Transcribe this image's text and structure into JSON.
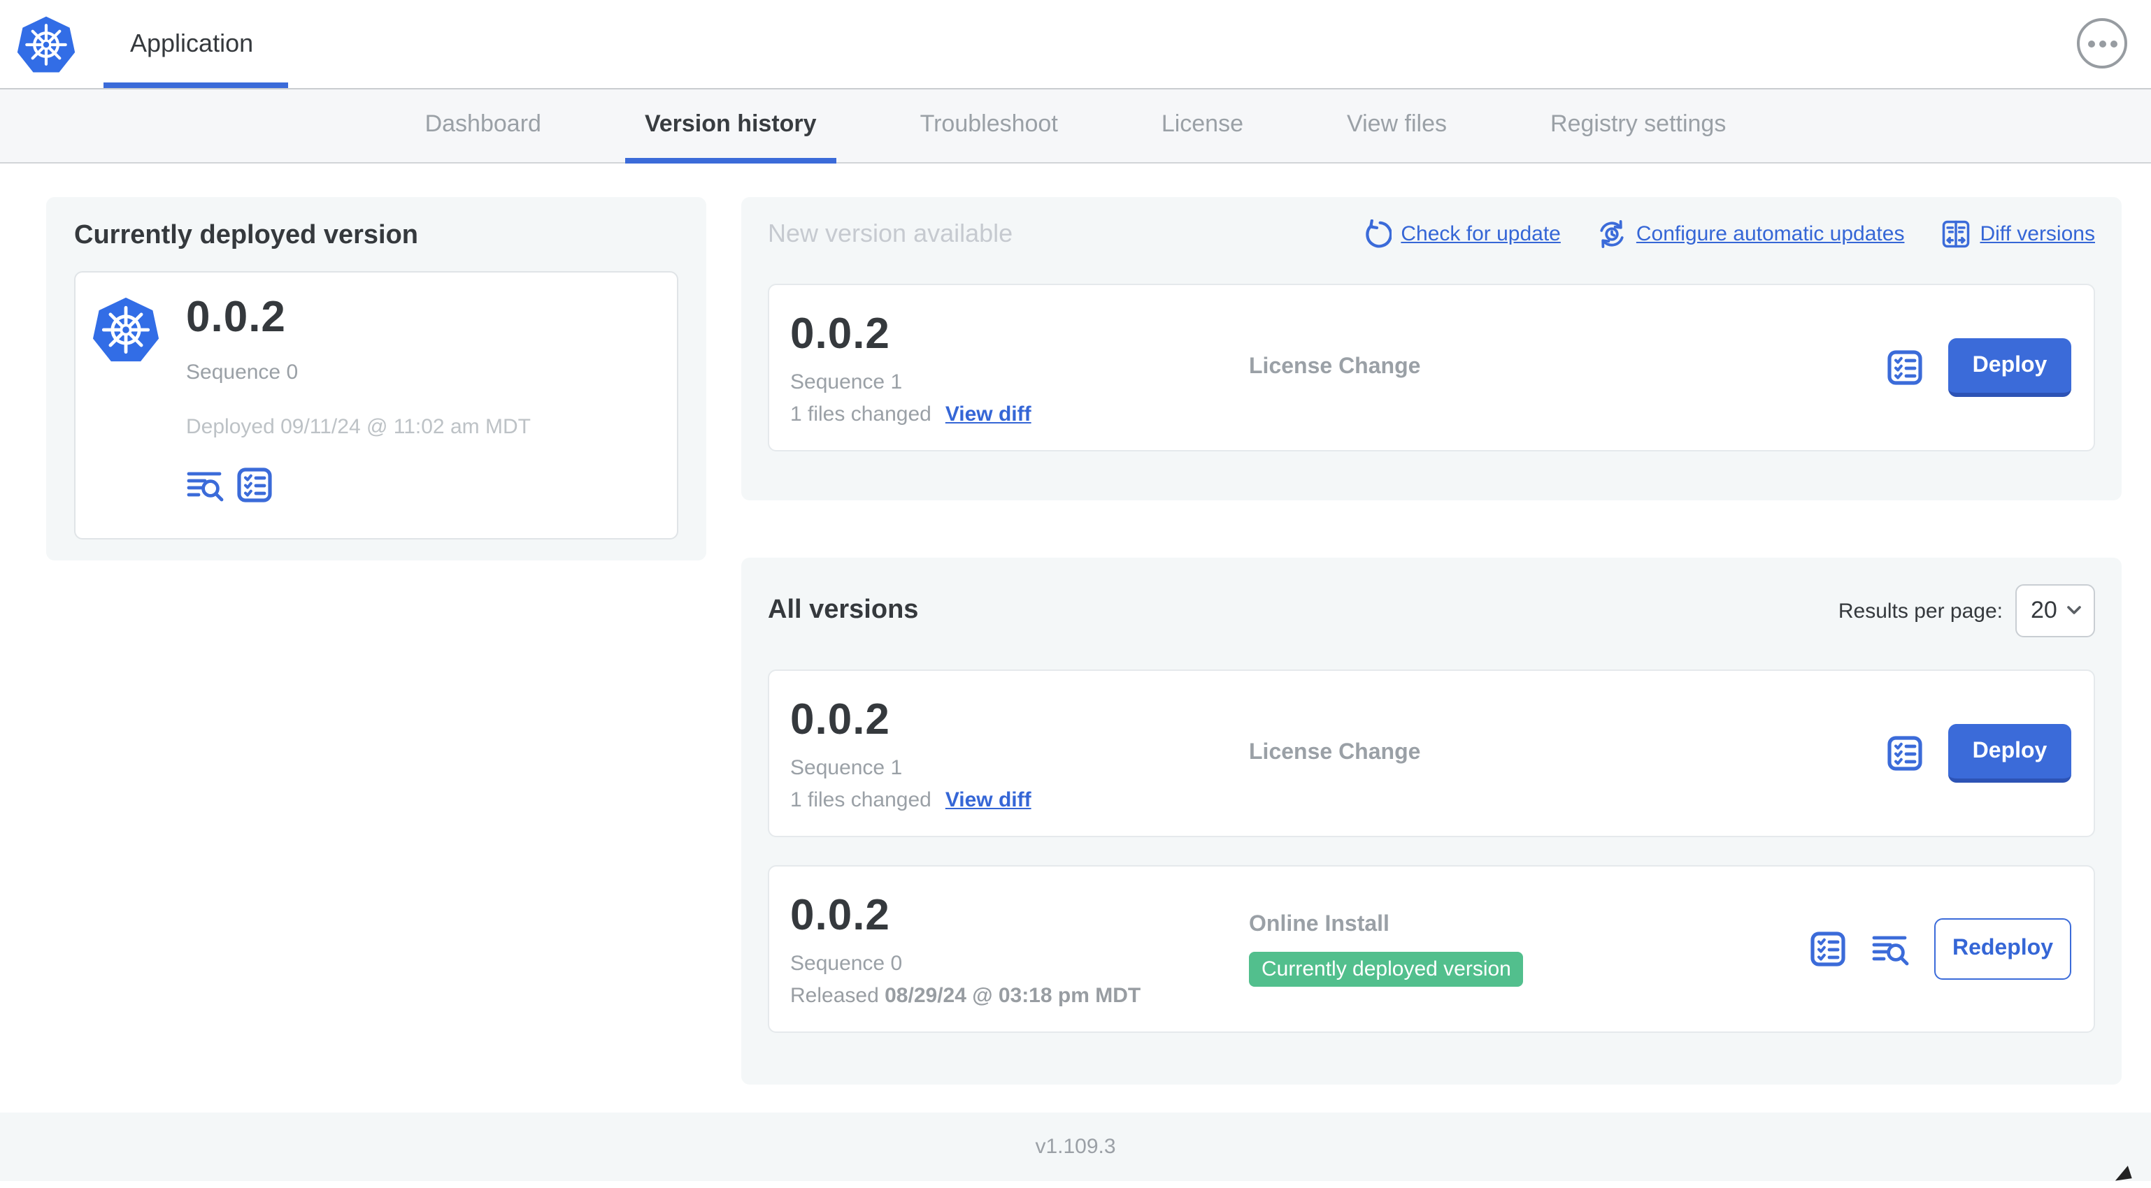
{
  "header": {
    "app_title": "Application"
  },
  "nav": {
    "tabs": [
      {
        "label": "Dashboard",
        "active": false
      },
      {
        "label": "Version history",
        "active": true
      },
      {
        "label": "Troubleshoot",
        "active": false
      },
      {
        "label": "License",
        "active": false
      },
      {
        "label": "View files",
        "active": false
      },
      {
        "label": "Registry settings",
        "active": false
      }
    ]
  },
  "currently_deployed": {
    "heading": "Currently deployed version",
    "version": "0.0.2",
    "sequence": "Sequence 0",
    "deployed": "Deployed 09/11/24 @ 11:02 am MDT"
  },
  "new_version": {
    "heading": "New version available",
    "check_for_update": "Check for update",
    "configure_auto_updates": "Configure automatic updates",
    "diff_versions": "Diff versions",
    "version": "0.0.2",
    "sequence": "Sequence 1",
    "files_changed": "1 files changed",
    "view_diff": "View diff",
    "source": "License Change",
    "deploy_label": "Deploy"
  },
  "all_versions": {
    "heading": "All versions",
    "results_per_page_label": "Results per page:",
    "results_per_page_value": "20",
    "rows": [
      {
        "version": "0.0.2",
        "sequence": "Sequence 1",
        "files_changed": "1 files changed",
        "view_diff": "View diff",
        "source": "License Change",
        "action": "Deploy"
      },
      {
        "version": "0.0.2",
        "sequence": "Sequence 0",
        "released_prefix": "Released",
        "released_date": "08/29/24 @ 03:18 pm MDT",
        "source": "Online Install",
        "badge": "Currently deployed version",
        "action": "Redeploy"
      }
    ]
  },
  "footer": {
    "version": "v1.109.3"
  },
  "colors": {
    "accent_blue": "#3b6bd9",
    "link_blue": "#3566d6",
    "k8s_logo_blue": "#326de6",
    "badge_green": "#52bf8d",
    "panel_gray": "#f4f7f8"
  },
  "icons": {
    "app-logo-icon": "kubernetes-wheel-heptagon",
    "ellipsis-icon": "three-horizontal-dots-circle",
    "refresh-icon": "circular-arrow",
    "schedule-update-icon": "circular-arrows-with-clock",
    "diff-icon": "split-panel-with-arrows",
    "logs-icon": "text-lines-with-magnifier",
    "checklist-icon": "boxed-checklist",
    "chevron-down-icon": "chevron-down"
  }
}
